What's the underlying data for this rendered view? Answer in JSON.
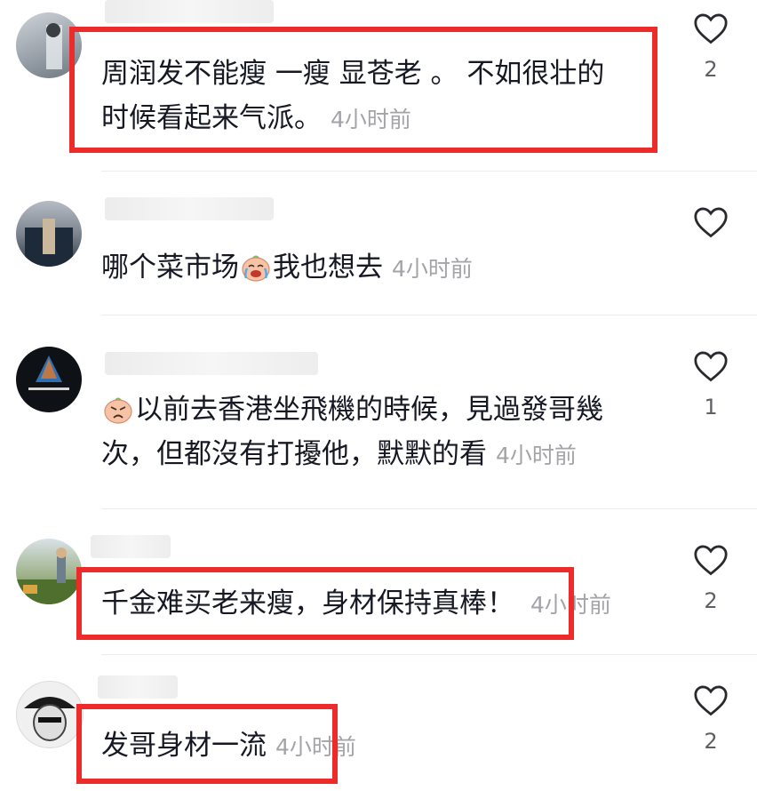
{
  "comments": [
    {
      "lines": [
        "周润发不能瘦 一瘦 显苍老 。 不如很壮的",
        "时候看起来气派。"
      ],
      "time": "4小时前",
      "likes": "2",
      "highlighted": true
    },
    {
      "text": "哪个菜市场",
      "emoji": "crying-laughing-peach-emoji",
      "text_after": "我也想去",
      "time": "4小时前",
      "likes": "",
      "highlighted": false
    },
    {
      "emoji": "pouting-peach-emoji",
      "lines": [
        "以前去香港坐飛機的時候，見過發哥幾",
        "次，但都沒有打擾他，默默的看"
      ],
      "time": "4小时前",
      "likes": "1",
      "highlighted": false
    },
    {
      "text": "千金难买老来瘦，身材保持真棒！",
      "time": "4小时前",
      "likes": "2",
      "highlighted": true
    },
    {
      "text": "发哥身材一流",
      "time": "4小时前",
      "likes": "2",
      "highlighted": true
    }
  ],
  "colors": {
    "highlight": "#ee2b2b",
    "time": "#a3a3a8",
    "text": "#161823"
  },
  "icons": {
    "like": "heart-outline-icon"
  }
}
